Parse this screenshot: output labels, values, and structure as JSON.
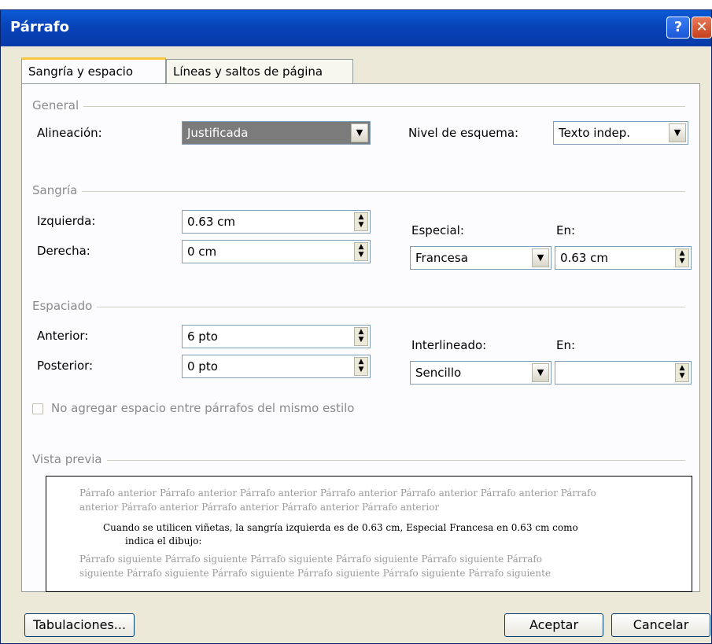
{
  "window": {
    "title": "Párrafo",
    "help_glyph": "?",
    "close_glyph": "✕"
  },
  "tabs": [
    {
      "label": "Sangría y espacio",
      "active": true
    },
    {
      "label": "Líneas y saltos de página",
      "active": false
    }
  ],
  "general": {
    "section": "General",
    "alineacion_label": "Alineación:",
    "alineacion_value": "Justificada",
    "nivel_label": "Nivel de esquema:",
    "nivel_value": "Texto indep."
  },
  "sangria": {
    "section": "Sangría",
    "izquierda_label": "Izquierda:",
    "izquierda_value": "0.63 cm",
    "derecha_label": "Derecha:",
    "derecha_value": "0 cm",
    "especial_label": "Especial:",
    "especial_value": "Francesa",
    "en_label": "En:",
    "en_value": "0.63 cm"
  },
  "espaciado": {
    "section": "Espaciado",
    "anterior_label": "Anterior:",
    "anterior_value": "6 pto",
    "posterior_label": "Posterior:",
    "posterior_value": "0 pto",
    "interlineado_label": "Interlineado:",
    "interlineado_value": "Sencillo",
    "en_label": "En:",
    "en_value": "",
    "checkbox_label": "No agregar espacio entre párrafos del mismo estilo"
  },
  "preview": {
    "section": "Vista previa",
    "prev_line1": "Párrafo anterior Párrafo anterior Párrafo anterior Párrafo anterior Párrafo anterior Párrafo anterior Párrafo",
    "prev_line2": "anterior Párrafo anterior Párrafo anterior Párrafo anterior Párrafo anterior",
    "main_line1": "Cuando se utilicen viñetas, la sangría izquierda es de 0.63 cm, Especial Francesa en 0.63 cm como",
    "main_line2": "indica el dibujo:",
    "next_line1": "Párrafo siguiente Párrafo siguiente Párrafo siguiente Párrafo siguiente Párrafo siguiente Párrafo",
    "next_line2": "siguiente Párrafo siguiente Párrafo siguiente Párrafo siguiente Párrafo siguiente Párrafo siguiente"
  },
  "buttons": {
    "tabulaciones": "Tabulaciones...",
    "aceptar": "Aceptar",
    "cancelar": "Cancelar"
  },
  "icons": {
    "spin": "spin-arrows-icon",
    "dropdown": "dropdown-arrow-icon"
  }
}
